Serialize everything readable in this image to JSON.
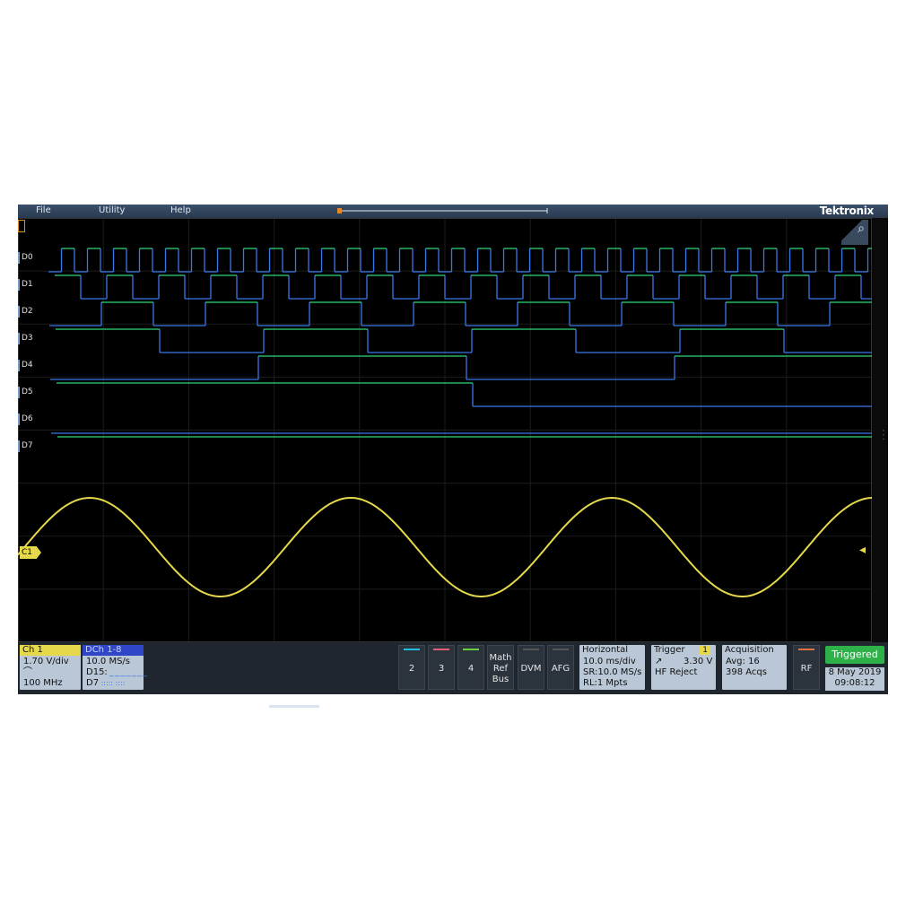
{
  "menu": {
    "file": "File",
    "utility": "Utility",
    "help": "Help",
    "brand": "Tektronix"
  },
  "channels": [
    "D0",
    "D1",
    "D2",
    "D3",
    "D4",
    "D5",
    "D6",
    "D7"
  ],
  "analog_label": "C1",
  "colors": {
    "digital_high": "#2fd87a",
    "digital_low": "#3b77e8",
    "analog": "#e5d84a",
    "ch2": "#20c0e0",
    "ch3": "#e0607a",
    "ch4": "#6ad040",
    "triggered": "#2fb14a"
  },
  "ch1": {
    "title": "Ch 1",
    "scale": "1.70 V/div",
    "bw": "100 MHz"
  },
  "dch": {
    "title": "DCh 1-8",
    "rate": "10.0 MS/s",
    "d15": "D15:",
    "d7": "D7"
  },
  "buttons": {
    "ch2": "2",
    "ch3": "3",
    "ch4": "4",
    "math": [
      "Math",
      "Ref",
      "Bus"
    ],
    "dvm": "DVM",
    "afg": "AFG",
    "rf": "RF"
  },
  "horizontal": {
    "title": "Horizontal",
    "scale": "10.0 ms/div",
    "sr": "SR:10.0 MS/s",
    "rl": "RL:1 Mpts"
  },
  "trigger": {
    "title": "Trigger",
    "source": "1",
    "level": "3.30 V",
    "mode": "HF Reject"
  },
  "acquisition": {
    "title": "Acquisition",
    "avg": "Avg: 16",
    "acqs": "398 Acqs"
  },
  "status": {
    "triggered": "Triggered",
    "date": "8 May 2019",
    "time": "09:08:12"
  },
  "icons": {
    "zoom": "magnifier-icon",
    "slope": "rising-edge-icon",
    "more": "vertical-dots-icon"
  }
}
